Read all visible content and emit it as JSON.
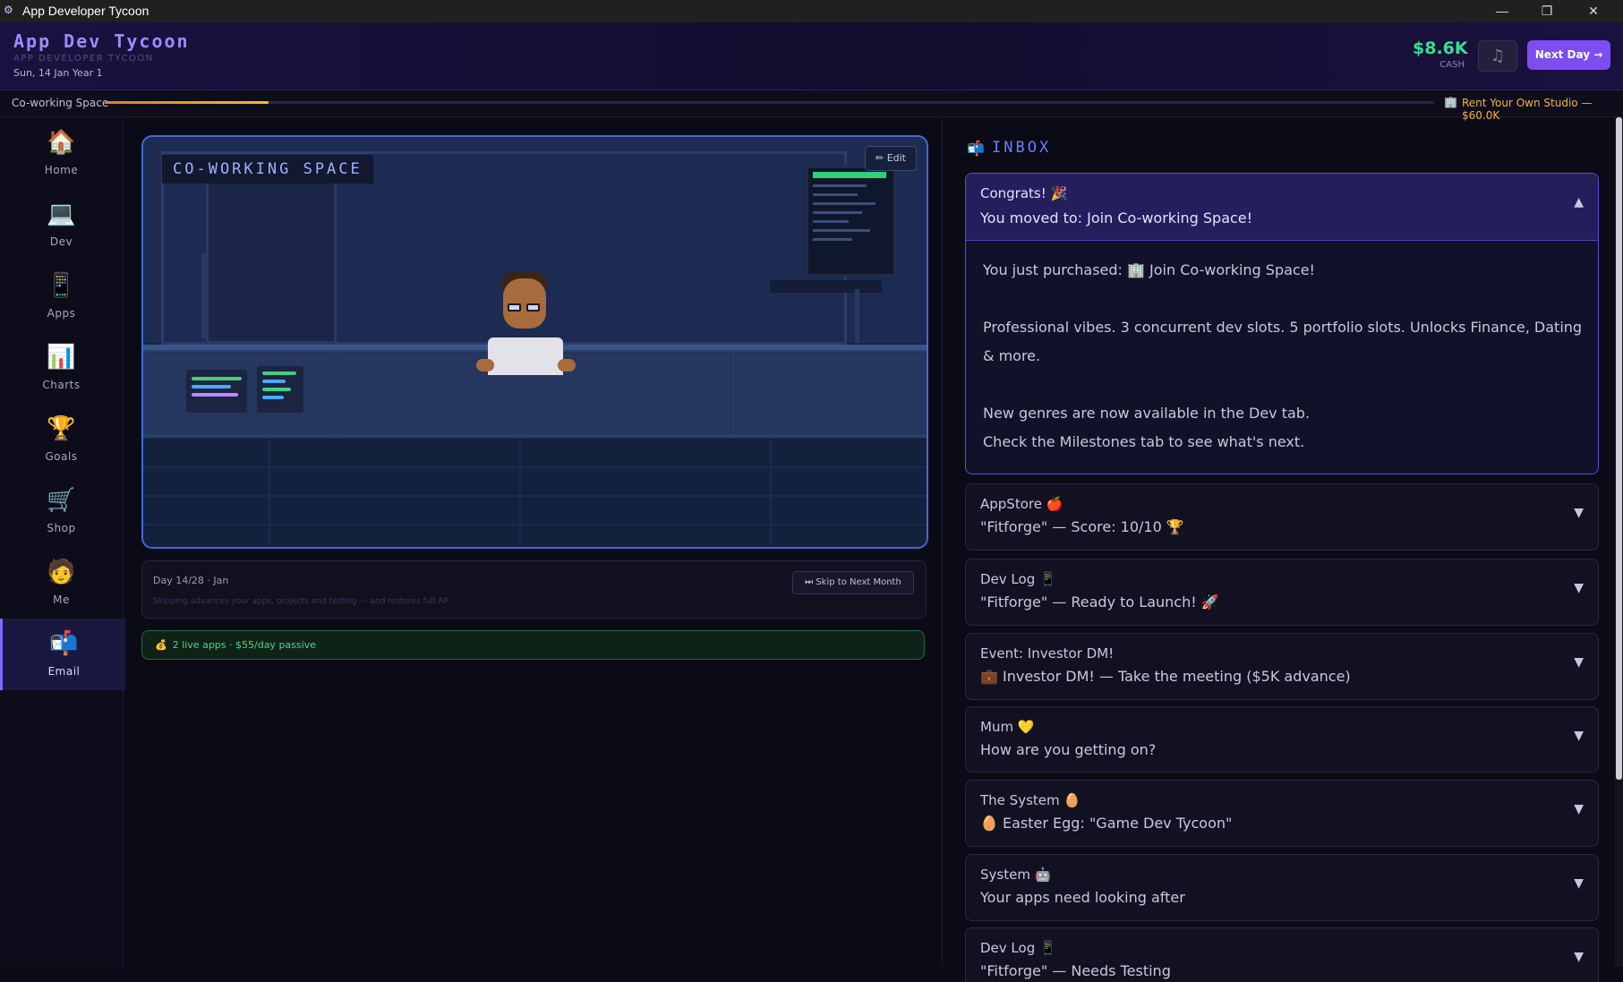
{
  "window": {
    "title": "App Developer Tycoon",
    "minimize": "—",
    "restore": "❐",
    "close": "✕"
  },
  "header": {
    "title": "App Dev Tycoon",
    "subtitle": "APP DEVELOPER TYCOON",
    "date": "Sun, 14 Jan Year 1",
    "cash_value": "$8.6K",
    "cash_label": "CASH",
    "music_icon": "♫",
    "next_day": "Next Day →"
  },
  "progress": {
    "location": "Co-working Space",
    "fraction": 0.123,
    "target": "Rent Your Own Studio — $60.0K",
    "target_icon": "🏢"
  },
  "sidebar": {
    "items": [
      {
        "label": "Home",
        "icon": "🏠"
      },
      {
        "label": "Dev",
        "icon": "💻"
      },
      {
        "label": "Apps",
        "icon": "📱"
      },
      {
        "label": "Charts",
        "icon": "📊"
      },
      {
        "label": "Goals",
        "icon": "🏆"
      },
      {
        "label": "Shop",
        "icon": "🛒"
      },
      {
        "label": "Me",
        "icon": "🧑"
      },
      {
        "label": "Email",
        "icon": "📬"
      }
    ],
    "active": "Email"
  },
  "scene": {
    "label": "CO-WORKING SPACE",
    "edit": "✏ Edit"
  },
  "day_card": {
    "label": "Day 14/28 · Jan",
    "hint": "Skipping advances your apps, projects and testing — and restores full AP.",
    "skip": "⏭ Skip to Next Month"
  },
  "passive": {
    "icon": "💰",
    "text": "2 live apps · $55/day passive"
  },
  "inbox": {
    "icon": "📬",
    "title": "INBOX",
    "open_mail": {
      "from": "Congrats! 🎉",
      "subject": "You moved to: Join Co-working Space!",
      "chevron": "▲",
      "body": [
        "You just purchased: 🏢 Join Co-working Space!",
        "Professional vibes. 3 concurrent dev slots. 5 portfolio slots. Unlocks Finance, Dating & more.",
        "New genres are now available in the Dev tab.",
        "Check the Milestones tab to see what's next."
      ]
    },
    "mails": [
      {
        "from": "AppStore 🍎",
        "subject": "\"Fitforge\" — Score: 10/10 🏆",
        "chevron": "▼"
      },
      {
        "from": "Dev Log 📱",
        "subject": "\"Fitforge\" — Ready to Launch! 🚀",
        "chevron": "▼"
      },
      {
        "from": "Event: Investor DM!",
        "subject": "💼 Investor DM! — Take the meeting ($5K advance)",
        "chevron": "▼"
      },
      {
        "from": "Mum 💛",
        "subject": "How are you getting on?",
        "chevron": "▼"
      },
      {
        "from": "The System 🥚",
        "subject": "🥚 Easter Egg: \"Game Dev Tycoon\"",
        "chevron": "▼"
      },
      {
        "from": "System 🤖",
        "subject": "Your apps need looking after",
        "chevron": "▼"
      },
      {
        "from": "Dev Log 📱",
        "subject": "\"Fitforge\" — Needs Testing",
        "chevron": "▼"
      }
    ]
  }
}
